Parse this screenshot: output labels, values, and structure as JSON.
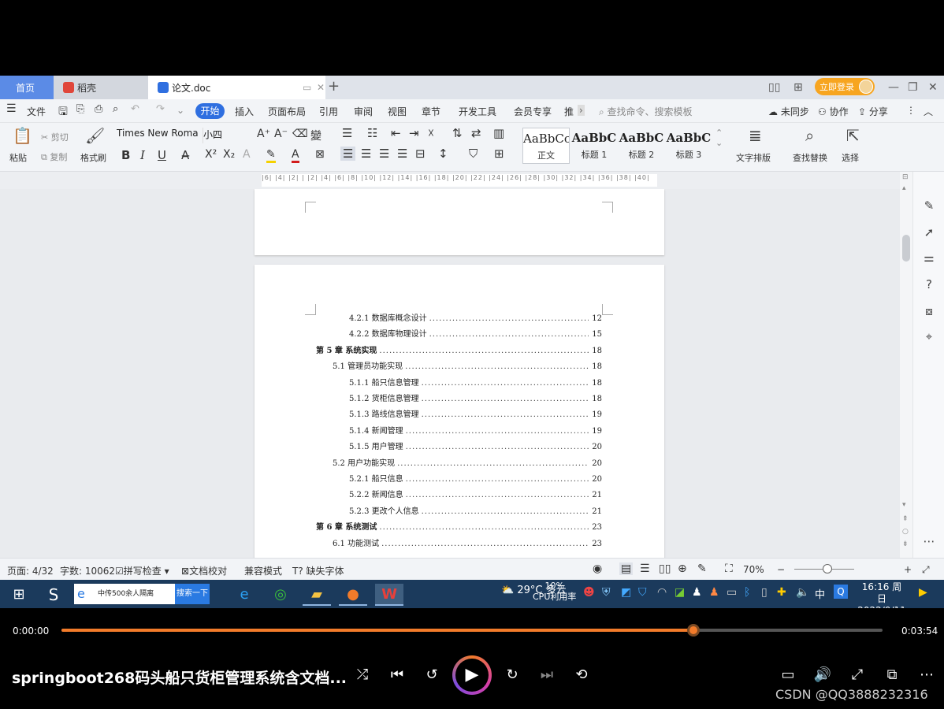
{
  "titlebar": {
    "tabs": [
      {
        "label": "首页"
      },
      {
        "label": "稻壳"
      },
      {
        "label": "论文.doc"
      }
    ],
    "new_tab": "+",
    "login": "立即登录"
  },
  "menubar": {
    "file": "文件",
    "items": [
      "开始",
      "插入",
      "页面布局",
      "引用",
      "审阅",
      "视图",
      "章节",
      "开发工具",
      "会员专享",
      "推"
    ],
    "search_placeholder": "查找命令、搜索模板",
    "right": [
      "未同步",
      "协作",
      "分享"
    ]
  },
  "ribbon": {
    "paste": "粘贴",
    "cut": "剪切",
    "copy": "复制",
    "format_painter": "格式刷",
    "font_name": "Times New Roma",
    "font_size": "小四",
    "styles": [
      {
        "preview": "AaBbCcI",
        "name": "正文"
      },
      {
        "preview": "AaBbC",
        "name": "标题 1"
      },
      {
        "preview": "AaBbC",
        "name": "标题 2"
      },
      {
        "preview": "AaBbC",
        "name": "标题 3"
      }
    ],
    "text_layout": "文字排版",
    "find_replace": "查找替换",
    "select": "选择"
  },
  "ruler": {
    "ticks": "|6| |4| |2| | |2| |4| |6| |8| |10| |12| |14| |16| |18| |20| |22| |24| |26| |28| |30| |32| |34| |36| |38| |40|"
  },
  "toc": [
    {
      "title": "4.2.1 数据库概念设计",
      "page": "12",
      "level": 3
    },
    {
      "title": "4.2.2 数据库物理设计",
      "page": "15",
      "level": 3
    },
    {
      "title": "第 5 章  系统实现",
      "page": "18",
      "level": 1
    },
    {
      "title": "5.1 管理员功能实现",
      "page": "18",
      "level": 2
    },
    {
      "title": "5.1.1 船只信息管理",
      "page": "18",
      "level": 3
    },
    {
      "title": "5.1.2 货柜信息管理",
      "page": "18",
      "level": 3
    },
    {
      "title": "5.1.3 路线信息管理",
      "page": "19",
      "level": 3
    },
    {
      "title": "5.1.4 新闻管理",
      "page": "19",
      "level": 3
    },
    {
      "title": "5.1.5 用户管理",
      "page": "20",
      "level": 3
    },
    {
      "title": "5.2 用户功能实现",
      "page": "20",
      "level": 2
    },
    {
      "title": "5.2.1 船只信息",
      "page": "20",
      "level": 3
    },
    {
      "title": "5.2.2 新闻信息",
      "page": "21",
      "level": 3
    },
    {
      "title": "5.2.3 更改个人信息",
      "page": "21",
      "level": 3
    },
    {
      "title": "第 6 章  系统测试",
      "page": "23",
      "level": 1
    },
    {
      "title": "6.1 功能测试",
      "page": "23",
      "level": 2
    }
  ],
  "status": {
    "page": "页面: 4/32",
    "words": "字数: 10062",
    "spell": "拼写检查",
    "proof": "文档校对",
    "compat": "兼容模式",
    "missing_font": "缺失字体",
    "zoom": "70%"
  },
  "taskbar": {
    "search_text": "中传500余人隔离",
    "search_button": "搜索一下",
    "weather": "29°C 多云",
    "cpu_percent": "10%",
    "cpu_label": "CPU利用率",
    "ime": "中",
    "time": "16:16 周日",
    "date": "2022/9/11"
  },
  "player": {
    "current_time": "0:00:00",
    "total_time": "0:03:54",
    "progress": 0.77,
    "title": "springboot268码头船只货柜管理系统含文档...",
    "watermark": "CSDN @QQ3888232316"
  }
}
